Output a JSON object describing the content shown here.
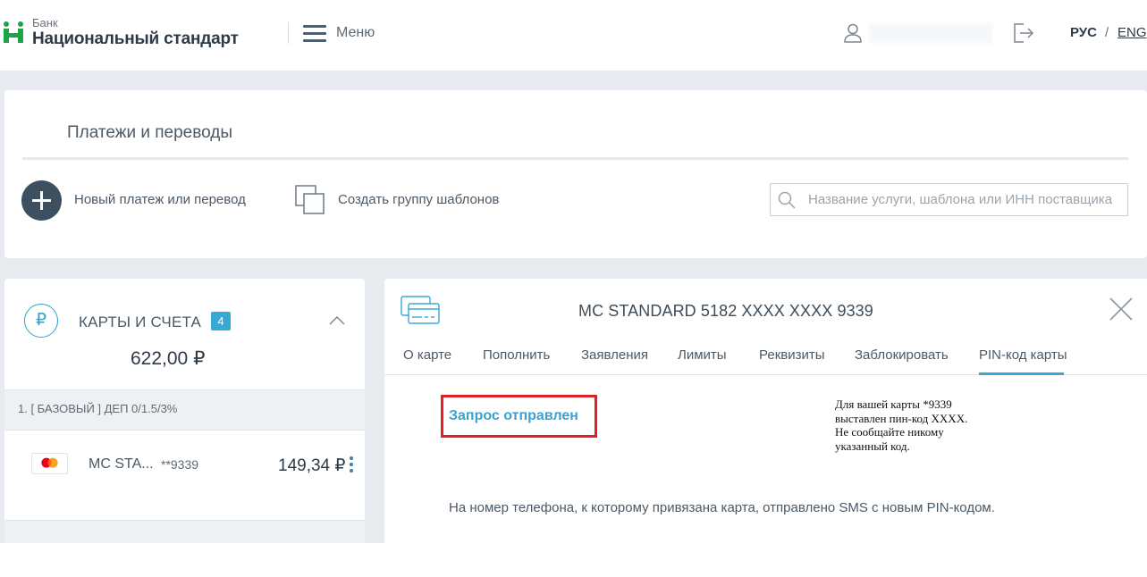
{
  "header": {
    "bank_small": "Банк",
    "bank_name": "Национальный стандарт",
    "menu_label": "Меню",
    "lang_ru": "РУС",
    "lang_sep": "/",
    "lang_en": "ENG"
  },
  "payments": {
    "title": "Платежи и переводы",
    "new_payment_label": "Новый платеж или перевод",
    "create_group_label": "Создать группу шаблонов",
    "search_placeholder": "Название услуги, шаблона или ИНН поставщика"
  },
  "cards_panel": {
    "title": "КАРТЫ И СЧЕТА",
    "count": "4",
    "total": "622,00 ₽",
    "ruble_symbol": "₽",
    "account_label": "1. [ БАЗОВЫЙ ] ДЕП 0/1.5/3%",
    "card": {
      "name": "MC  STA...",
      "mask": "**9339",
      "amount": "149,34 ₽"
    }
  },
  "detail": {
    "title": "MC STANDARD 5182 XXXX XXXX 9339",
    "tabs": [
      {
        "label": "О карте"
      },
      {
        "label": "Пополнить"
      },
      {
        "label": "Заявления"
      },
      {
        "label": "Лимиты"
      },
      {
        "label": "Реквизиты"
      },
      {
        "label": "Заблокировать"
      },
      {
        "label": "PIN-код карты"
      }
    ],
    "active_tab": "PIN-код карты",
    "status": "Запрос отправлен",
    "pin_note_lines": [
      "Для вашей карты *9339",
      "выставлен пин-код XXXX.",
      "Не сообщайте никому",
      "указанный код."
    ],
    "sms_message": "На номер телефона, к которому привязана карта, отправлено SMS с новым PIN-кодом."
  },
  "colors": {
    "accent": "#38a9d4",
    "brand_green": "#1fa34a",
    "highlight_red": "#e31e24",
    "background": "#e7eaee"
  }
}
